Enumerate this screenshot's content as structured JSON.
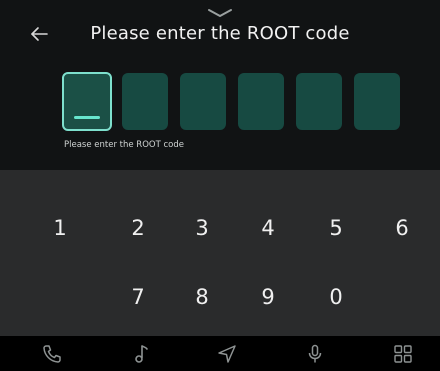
{
  "header": {
    "title": "Please enter the ROOT code",
    "back_icon": "back-arrow-icon",
    "pull_icon": "chevron-down-icon"
  },
  "code": {
    "slots": [
      "",
      "",
      "",
      "",
      "",
      ""
    ],
    "active_index": 0,
    "hint": "Please enter the ROOT code"
  },
  "keypad": {
    "row1": [
      "1",
      "2",
      "3",
      "4",
      "5",
      "6"
    ],
    "row2": [
      "7",
      "8",
      "9",
      "0"
    ]
  },
  "navbar": {
    "icons": [
      "phone-icon",
      "music-icon",
      "navigation-icon",
      "microphone-icon",
      "apps-grid-icon"
    ]
  },
  "colors": {
    "accent": "#68e5cd",
    "box": "#174a42",
    "keypad_bg": "#2a2b2c"
  }
}
